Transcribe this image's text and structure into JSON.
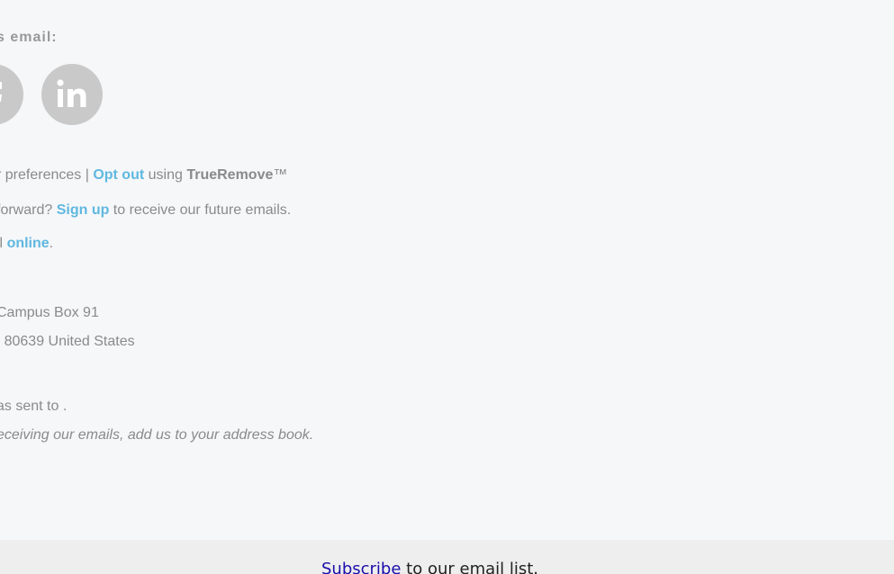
{
  "share": {
    "heading": "s email:",
    "icons": [
      "facebook-icon",
      "linkedin-icon"
    ]
  },
  "prefs": {
    "prefix": "r preferences | ",
    "opt_out": "Opt out",
    "using": " using ",
    "brand": "TrueRemove",
    "tm": "™"
  },
  "forward": {
    "prefix": "forward? ",
    "sign_up": "Sign up",
    "suffix": " to receive our future emails."
  },
  "online": {
    "prefix": "il ",
    "link": "online",
    "suffix": "."
  },
  "address": {
    "line1": "Campus Box 91",
    "line2": "| 80639 United States"
  },
  "sent_to": "as sent to .",
  "address_book": "eceiving our emails, add us to your address book.",
  "bottom": {
    "subscribe_link": "Subscribe",
    "subscribe_text": " to our email list."
  },
  "colors": {
    "background": "#f6f7f9",
    "link": "#5fb8e0",
    "text": "#8a8a8a",
    "icon": "#c9c9c9"
  }
}
